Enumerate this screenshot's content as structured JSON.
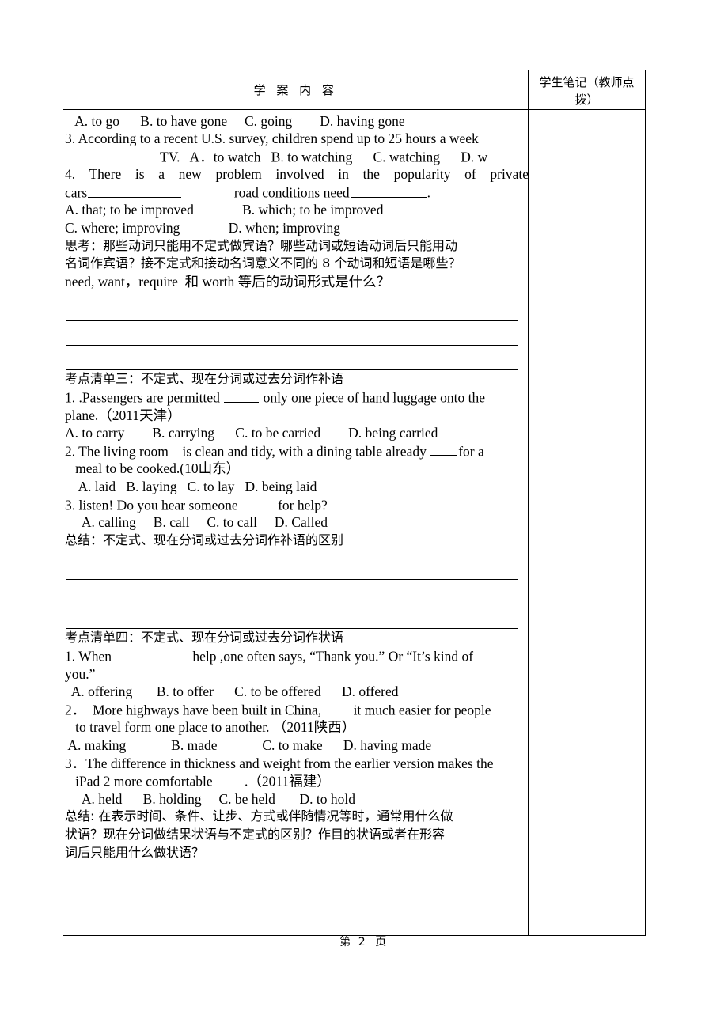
{
  "document": {
    "header": {
      "content_column_title": "学  案  内  容",
      "notes_column_title": "学生笔记（教师点拨）"
    },
    "footer": {
      "prefix": "第",
      "page_number": "2",
      "suffix": "页"
    }
  },
  "lines": {
    "q2_options": "   A. to go      B. to have gone     C. going        D. having gone",
    "q3_stem": "3. According to a recent U.S. survey, children spend up to 25 hours a week",
    "q3_options": "TV.   A．to watch   B. to watching      C. watching      D. w",
    "q4_stem": "4.  There  is  a  new  problem  involved  in  the  popularity  of  private",
    "q4_stem2_a": "cars",
    "q4_stem2_b": "road conditions need",
    "q4_stem2_c": ".",
    "q4_opt_ab": "A. that; to be improved              B. which; to be improved",
    "q4_opt_cd": "C. where; improving              D. when; improving",
    "think_1": "思考：那些动词只能用不定式做宾语？哪些动词或短语动词后只能用动",
    "think_2": "名词作宾语？接不定式和接动名词意义不同的 8 个动词和短语是哪些？",
    "think_3": "need, want，require  和 worth 等后的动词形式是什么？",
    "section3_title": "考点清单三：不定式、现在分词或过去分词作补语",
    "s3_q1_a": "1. .Passengers are permitted ",
    "s3_q1_b": " only one piece of hand luggage onto the",
    "s3_q1_c": "plane.（2011天津）",
    "s3_q1_options": "A. to carry        B. carrying      C. to be carried        D. being carried",
    "s3_q2_a": "2. The living room    is clean and tidy, with a dining table already ",
    "s3_q2_b": "for a",
    "s3_q2_c": "   meal to be cooked.(10山东）",
    "s3_q2_options": "    A. laid   B. laying   C. to lay   D. being laid",
    "s3_q3_a": "3. listen! Do you hear someone ",
    "s3_q3_b": "for help?",
    "s3_q3_options": "     A. calling     B. call     C. to call     D. Called",
    "s3_summary": "总结：不定式、现在分词或过去分词作补语的区别",
    "section4_title": "考点清单四：不定式、现在分词或过去分词作状语",
    "s4_q1_a": "1. When ",
    "s4_q1_b": "help ,one often says, “Thank you.” Or “It’s kind of",
    "s4_q1_c": "you.”",
    "s4_q1_options": "  A. offering       B. to offer      C. to be offered      D. offered",
    "s4_q2_a": "2．  More highways have been built in China, ",
    "s4_q2_b": "it much easier for people",
    "s4_q2_c": "   to travel form one place to another. （2011陕西）",
    "s4_q2_options": " A. making             B. made             C. to make      D. having made",
    "s4_q3_a": "3．The difference in thickness and weight from the earlier version makes the",
    "s4_q3_b": "   iPad 2 more comfortable ",
    "s4_q3_c": ".（2011福建）",
    "s4_q3_options": "     A. held      B. holding     C. be held       D. to hold",
    "s4_summary_1": "总结: 在表示时间、条件、让步、方式或伴随情况等时，通常用什么做",
    "s4_summary_2": "状语？现在分词做结果状语与不定式的区别？作目的状语或者在形容",
    "s4_summary_3": "词后只能用什么做状语？"
  }
}
